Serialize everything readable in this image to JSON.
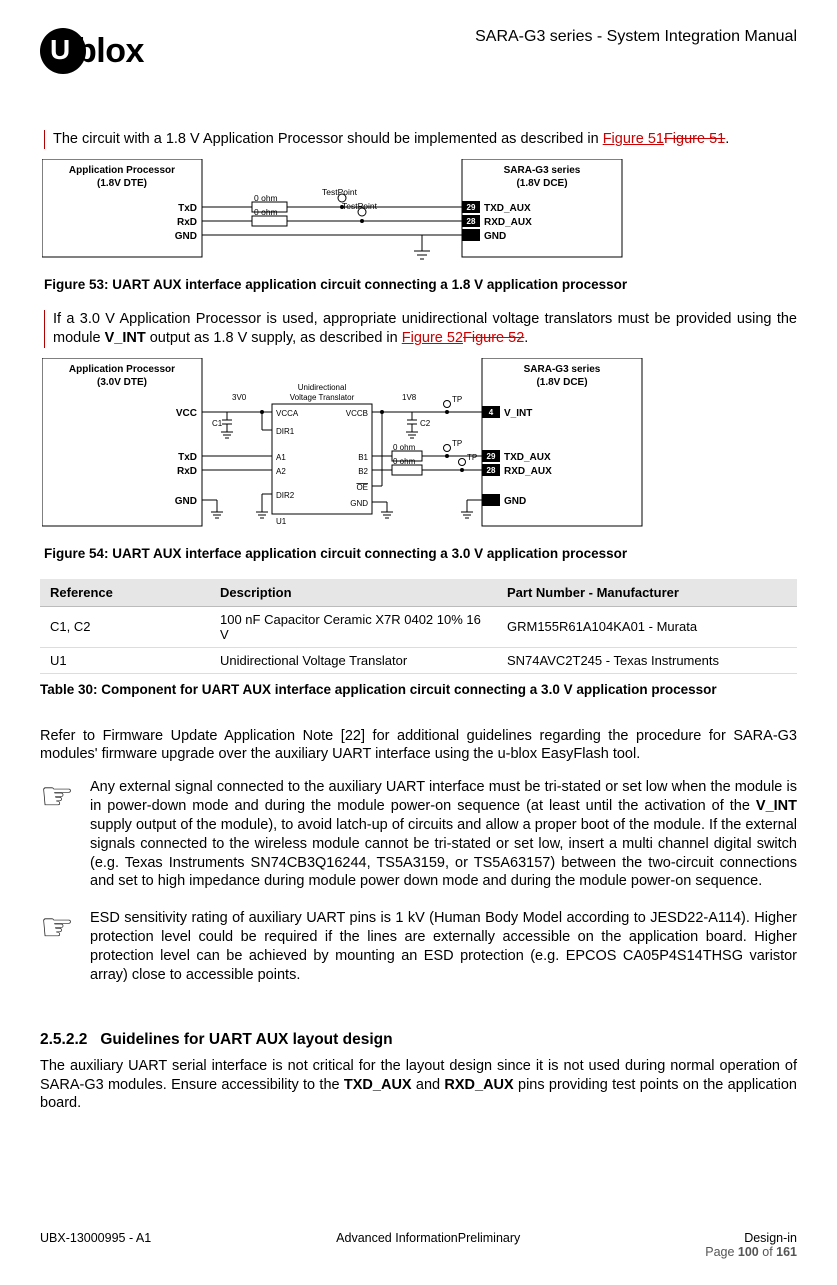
{
  "header": {
    "logo_red": "U",
    "logo_text": "blox",
    "doc_title": "SARA-G3 series - System Integration Manual"
  },
  "intro18": {
    "p1_a": "The circuit with a 1.8 V Application Processor should be implemented as described in ",
    "link1": "Figure 51",
    "link_strike1": "Figure 51",
    "p1_b": "."
  },
  "fig53": {
    "ap_title1": "Application Processor",
    "ap_title2": "(1.8V DTE)",
    "mod_title1": "SARA-G3 series",
    "mod_title2": "(1.8V DCE)",
    "ap_txd": "TxD",
    "ap_rxd": "RxD",
    "ap_gnd": "GND",
    "r0a": "0 ohm",
    "tp_a": "TestPoint",
    "r0b": "0 ohm",
    "tp_b": "TestPoint",
    "pin29": "29",
    "txd_aux": "TXD_AUX",
    "pin28": "28",
    "rxd_aux": "RXD_AUX",
    "mod_gnd": "GND",
    "caption": "Figure 53: UART AUX interface application circuit connecting a 1.8 V application processor"
  },
  "intro30": {
    "p1_a": "If a 3.0 V Application Processor is used, appropriate unidirectional voltage translators must be provided using the module ",
    "b1": "V_INT",
    "p1_b": " output as 1.8 V supply, as described in ",
    "link1": "Figure 52",
    "link_strike1": "Figure 52",
    "p1_c": "."
  },
  "fig54": {
    "ap_title1": "Application Processor",
    "ap_title2": "(3.0V DTE)",
    "mod_title1": "SARA-G3 series",
    "mod_title2": "(1.8V DCE)",
    "ap_vcc": "VCC",
    "ap_txd": "TxD",
    "ap_rxd": "RxD",
    "ap_gnd": "GND",
    "rail3v0": "3V0",
    "rail1v8": "1V8",
    "trans_lbl1": "Unidirectional",
    "trans_lbl2": "Voltage Translator",
    "c1": "C1",
    "c2": "C2",
    "vcca": "VCCA",
    "vccb": "VCCB",
    "dir1": "DIR1",
    "a1": "A1",
    "b1": "B1",
    "a2": "A2",
    "b2": "B2",
    "dir2": "DIR2",
    "oe": "OE",
    "gnd": "GND",
    "u1": "U1",
    "r0a": "0 ohm",
    "r0b": "0 ohm",
    "tp": "TP",
    "pin4": "4",
    "vint": "V_INT",
    "pin29": "29",
    "txd_aux": "TXD_AUX",
    "pin28": "28",
    "rxd_aux": "RXD_AUX",
    "mod_gnd": "GND",
    "caption": "Figure 54: UART AUX interface application circuit connecting a 3.0 V application processor"
  },
  "table30": {
    "h_ref": "Reference",
    "h_desc": "Description",
    "h_part": "Part Number - Manufacturer",
    "r1_ref": "C1, C2",
    "r1_desc": "100 nF Capacitor Ceramic X7R 0402 10% 16 V",
    "r1_part": "GRM155R61A104KA01 - Murata",
    "r2_ref": "U1",
    "r2_desc": "Unidirectional Voltage Translator",
    "r2_part": "SN74AVC2T245 - Texas Instruments",
    "caption": "Table 30: Component for UART AUX interface application circuit connecting a 3.0 V application processor"
  },
  "fw_note": "Refer to Firmware Update Application Note [22] for additional guidelines regarding the procedure for SARA-G3 modules' firmware upgrade over the auxiliary UART interface using the u-blox EasyFlash tool.",
  "note1": {
    "a": "Any external signal connected to the auxiliary UART interface must be tri-stated or set low when the module is in power-down mode and during the module power-on sequence (at least until the activation of the ",
    "b1": "V_INT",
    "b": " supply output of the module), to avoid latch-up of circuits and allow a proper boot of the module. If the external signals connected to the wireless module cannot be tri-stated or set low, insert a multi channel digital switch (e.g. Texas Instruments SN74CB3Q16244, TS5A3159, or TS5A63157) between the two-circuit connections and set to high impedance during module power down mode and during the module power-on sequence."
  },
  "note2": "ESD sensitivity rating of auxiliary UART pins is 1 kV (Human Body Model according to JESD22-A114). Higher protection level could be required if the lines are externally accessible on the application board. Higher protection level can be achieved by mounting an ESD protection (e.g. EPCOS CA05P4S14THSG varistor array) close to accessible points.",
  "section2522": {
    "num": "2.5.2.2",
    "title": "Guidelines for UART AUX layout design",
    "p_a": "The auxiliary UART serial interface is not critical for the layout design since it is not used during normal operation of SARA-G3 modules. Ensure accessibility to the ",
    "b1": "TXD_AUX",
    "p_b": " and ",
    "b2": "RXD_AUX",
    "p_c": " pins providing test points on the application board."
  },
  "footer": {
    "left": "UBX-13000995 - A1",
    "center": "Advanced InformationPreliminary",
    "right1": "Design-in",
    "right2_a": "Page ",
    "right2_b": "100",
    "right2_c": " of ",
    "right2_d": "161"
  }
}
